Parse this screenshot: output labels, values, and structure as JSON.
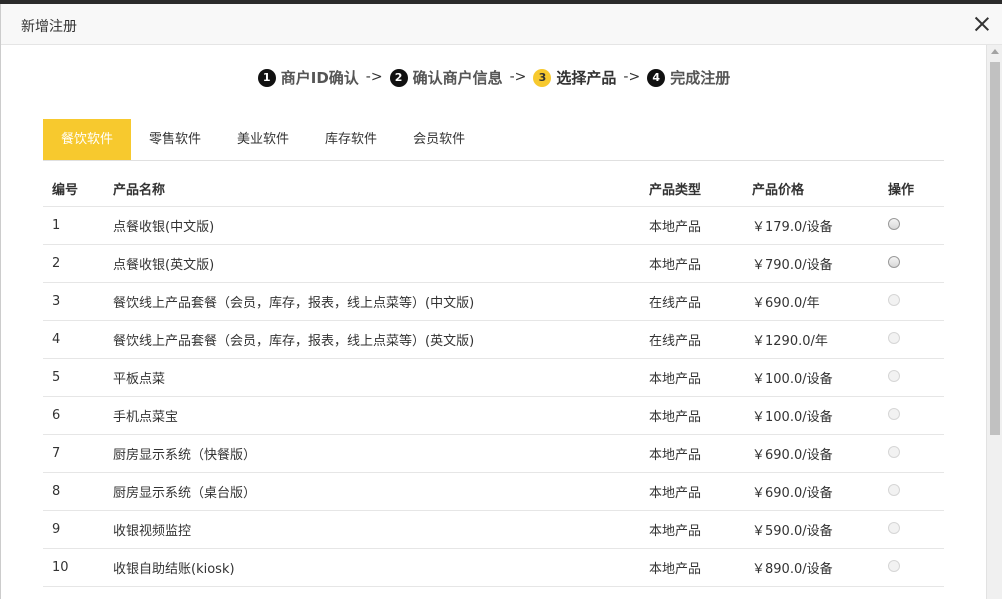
{
  "dialog": {
    "title": "新增注册"
  },
  "steps": [
    {
      "num": "1",
      "label": "商户ID确认",
      "active": false
    },
    {
      "num": "2",
      "label": "确认商户信息",
      "active": false
    },
    {
      "num": "3",
      "label": "选择产品",
      "active": true
    },
    {
      "num": "4",
      "label": "完成注册",
      "active": false
    }
  ],
  "step_separator": "->",
  "tabs": [
    {
      "label": "餐饮软件",
      "active": true
    },
    {
      "label": "零售软件",
      "active": false
    },
    {
      "label": "美业软件",
      "active": false
    },
    {
      "label": "库存软件",
      "active": false
    },
    {
      "label": "会员软件",
      "active": false
    }
  ],
  "table": {
    "headers": {
      "no": "编号",
      "name": "产品名称",
      "type": "产品类型",
      "price": "产品价格",
      "op": "操作"
    },
    "rows": [
      {
        "no": "1",
        "name": "点餐收银(中文版)",
        "type": "本地产品",
        "price": "￥179.0/设备",
        "selectable": true
      },
      {
        "no": "2",
        "name": "点餐收银(英文版)",
        "type": "本地产品",
        "price": "￥790.0/设备",
        "selectable": true
      },
      {
        "no": "3",
        "name": "餐饮线上产品套餐（会员，库存，报表，线上点菜等）(中文版)",
        "type": "在线产品",
        "price": "￥690.0/年",
        "selectable": false
      },
      {
        "no": "4",
        "name": "餐饮线上产品套餐（会员，库存，报表，线上点菜等）(英文版)",
        "type": "在线产品",
        "price": "￥1290.0/年",
        "selectable": false
      },
      {
        "no": "5",
        "name": "平板点菜",
        "type": "本地产品",
        "price": "￥100.0/设备",
        "selectable": false
      },
      {
        "no": "6",
        "name": "手机点菜宝",
        "type": "本地产品",
        "price": "￥100.0/设备",
        "selectable": false
      },
      {
        "no": "7",
        "name": "厨房显示系统（快餐版）",
        "type": "本地产品",
        "price": "￥690.0/设备",
        "selectable": false
      },
      {
        "no": "8",
        "name": "厨房显示系统（桌台版）",
        "type": "本地产品",
        "price": "￥690.0/设备",
        "selectable": false
      },
      {
        "no": "9",
        "name": "收银视频监控",
        "type": "本地产品",
        "price": "￥590.0/设备",
        "selectable": false
      },
      {
        "no": "10",
        "name": "收银自助结账(kiosk)",
        "type": "本地产品",
        "price": "￥890.0/设备",
        "selectable": false
      }
    ]
  },
  "colors": {
    "accent": "#f7c92e",
    "step_badge": "#111111"
  }
}
